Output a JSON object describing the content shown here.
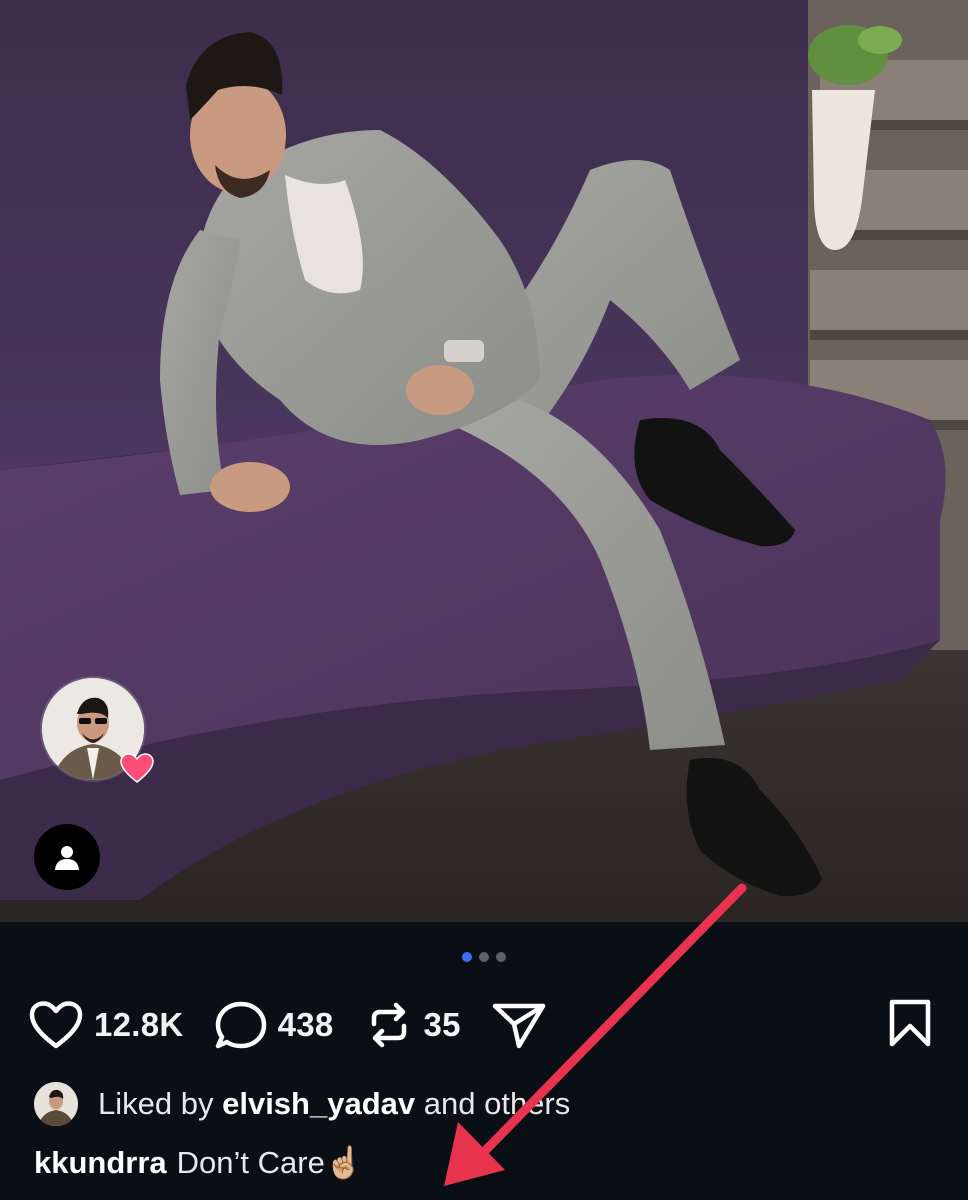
{
  "post": {
    "carousel": {
      "total": 3,
      "active_index": 0
    },
    "likes_count": "12.8K",
    "comments_count": "438",
    "reposts_count": "35",
    "liked_by": {
      "prefix": "Liked by",
      "username": "elvish_yadav",
      "suffix": "and others"
    },
    "caption": {
      "username": "kkundrra",
      "text": "Don’t Care",
      "emoji": "☝🏼"
    }
  },
  "colors": {
    "background": "#0a0e15",
    "active_dot": "#3d6ef5",
    "arrow": "#e8334f",
    "heart_badge": "#ff4d7a"
  },
  "icons": {
    "like": "heart-outline-icon",
    "comment": "comment-bubble-icon",
    "repost": "repost-icon",
    "share": "send-icon",
    "save": "bookmark-icon",
    "user_tags": "person-icon"
  }
}
